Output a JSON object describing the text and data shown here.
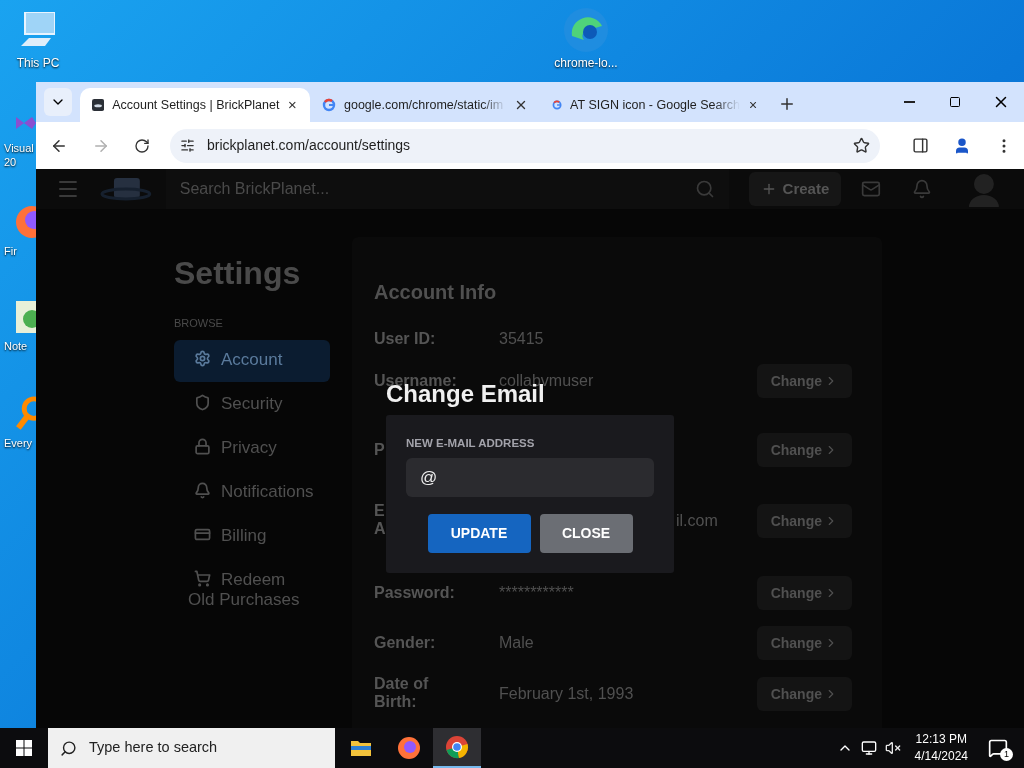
{
  "desktop": {
    "icons": [
      {
        "label": "This PC",
        "kind": "pc"
      },
      {
        "label": "Visual\n20",
        "kind": "vs"
      },
      {
        "label": "Fir",
        "kind": "firefox"
      },
      {
        "label": "Note",
        "kind": "notepad"
      },
      {
        "label": "Every",
        "kind": "search"
      }
    ],
    "top_icon": {
      "label": "chrome-lo..."
    }
  },
  "browser": {
    "tabs": [
      {
        "title": "Account Settings | BrickPlanet",
        "selected": true,
        "kind": "site"
      },
      {
        "title": "google.com/chrome/static/im",
        "selected": false,
        "kind": "google"
      },
      {
        "title": "AT SIGN icon - Google Search",
        "selected": false,
        "kind": "google"
      }
    ],
    "url": "brickplanet.com/account/settings"
  },
  "site": {
    "header": {
      "search_placeholder": "Search BrickPlanet...",
      "create_button": "Create"
    },
    "sidebar": {
      "title": "Settings",
      "section": "BROWSE",
      "items": [
        {
          "label": "Account",
          "kind": "gear",
          "selected": true
        },
        {
          "label": "Security",
          "kind": "shield",
          "selected": false
        },
        {
          "label": "Privacy",
          "kind": "lock",
          "selected": false
        },
        {
          "label": "Notifications",
          "kind": "bell",
          "selected": false
        },
        {
          "label": "Billing",
          "kind": "billing",
          "selected": false
        },
        {
          "label": "Redeem Old Purchases",
          "kind": "cart",
          "selected": false
        }
      ]
    },
    "account_info": {
      "title": "Account Info",
      "rows": [
        {
          "label": "User ID:",
          "value": "35415"
        },
        {
          "label": "Username:",
          "value": "collabvmuser",
          "button": "Change"
        },
        {
          "label": "P",
          "button": "Change"
        },
        {
          "label": "E\nA",
          "value": "il.com",
          "button": "Change"
        },
        {
          "label": "Password:",
          "value": "************",
          "button": "Change"
        },
        {
          "label": "Gender:",
          "value": "Male",
          "button": "Change"
        },
        {
          "label": "Date of\nBirth:",
          "value": "February 1st, 1993",
          "button": "Change"
        }
      ]
    }
  },
  "modal": {
    "title": "Change Email",
    "field_label": "NEW E-MAIL ADDRESS",
    "value": "@",
    "buttons": [
      {
        "label": "UPDATE",
        "kind": "primary"
      },
      {
        "label": "CLOSE",
        "kind": "secondary"
      }
    ]
  },
  "taskbar": {
    "search_placeholder": "Type here to search",
    "apps": [
      {
        "kind": "explorer",
        "active": false
      },
      {
        "kind": "firefox",
        "active": false
      },
      {
        "kind": "chrome",
        "active": true
      }
    ],
    "time": "12:13 PM",
    "date": "4/14/2024",
    "notification_count": "1"
  }
}
